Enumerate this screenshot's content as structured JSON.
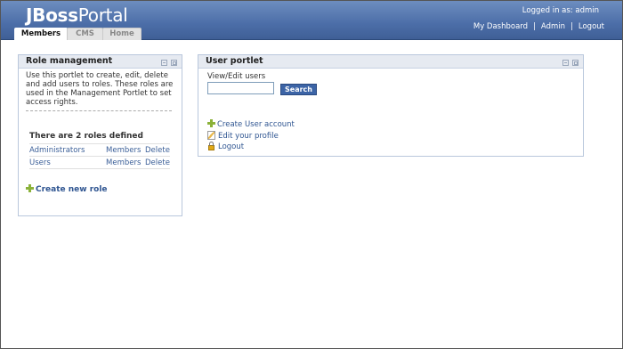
{
  "header": {
    "logo_bold": "JBoss",
    "logo_rest": "Portal",
    "login_text": "Logged in as: admin",
    "links": [
      "My Dashboard",
      "Admin",
      "Logout"
    ],
    "link_sep": "|"
  },
  "tabs": [
    {
      "label": "Members",
      "active": true
    },
    {
      "label": "CMS",
      "active": false
    },
    {
      "label": "Home",
      "active": false
    }
  ],
  "role_portlet": {
    "title": "Role management",
    "description": "Use this portlet to create, edit, delete and add users to roles. These roles are used in the Management Portlet to set access rights.",
    "roles_heading": "There are 2 roles defined",
    "roles": [
      {
        "name": "Administrators",
        "members": "Members",
        "delete": "Delete"
      },
      {
        "name": "Users",
        "members": "Members",
        "delete": "Delete"
      }
    ],
    "create_label": "Create new role"
  },
  "user_portlet": {
    "title": "User portlet",
    "search_label": "View/Edit users",
    "search_value": "",
    "search_button": "Search",
    "actions": [
      {
        "label": "Create User account",
        "icon": "plus-icon"
      },
      {
        "label": "Edit your profile",
        "icon": "edit-icon"
      },
      {
        "label": "Logout",
        "icon": "lock-icon"
      }
    ]
  },
  "colors": {
    "header_bg": "#4c6ea8",
    "link": "#2f5591",
    "button_bg": "#3c64a6",
    "portlet_title_bg": "#e6eaf1"
  }
}
